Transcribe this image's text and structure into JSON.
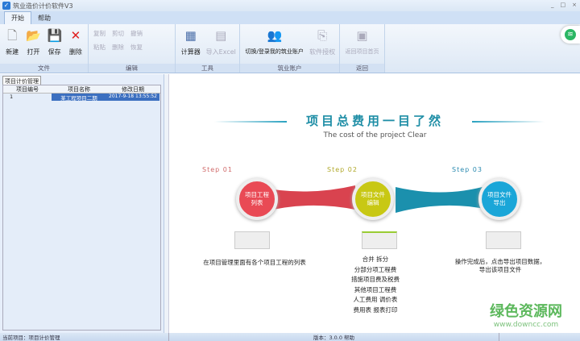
{
  "window": {
    "title": "筑业造价计价软件V3",
    "minimize": "_",
    "maximize": "□",
    "close": "×"
  },
  "tabs": [
    {
      "label": "开始"
    },
    {
      "label": "帮助"
    }
  ],
  "ribbon": {
    "file": {
      "label": "文件",
      "buttons": [
        "新建",
        "打开",
        "保存",
        "删除"
      ]
    },
    "edit": {
      "label": "编辑",
      "buttons": [
        "复制",
        "粘贴",
        "剪切",
        "删除",
        "撤销",
        "恢复"
      ]
    },
    "tools": {
      "label": "工具",
      "buttons": [
        "计算器",
        "导入Excel"
      ]
    },
    "account": {
      "label": "筑业账户",
      "buttons": [
        "切换/登录我的筑业账户",
        "软件授权"
      ]
    },
    "back": {
      "label": "返回",
      "buttons": [
        "返回项目首页"
      ]
    }
  },
  "left": {
    "tab": "项目计价管理",
    "columns": [
      "项目编号",
      "项目名称",
      "修改日期"
    ],
    "rows": [
      {
        "no": "1",
        "name": "某工程项目二期",
        "date": "2017-9-18 13:55:52"
      }
    ]
  },
  "content": {
    "title": "项目总费用一目了然",
    "subtitle": "The cost of the project Clear",
    "steps": [
      {
        "step": "Step 01",
        "label": "项目工程\n列表",
        "desc": "在项目管理里面有各个项目工程的列表",
        "color": "#e94a55",
        "stepcolor": "#d06a6a"
      },
      {
        "step": "Step 02",
        "label": "项目文件\n编辑",
        "desc": "合并  拆分\n分部分项工程费\n措施项目费及税费\n其他项目工程费\n人工费用  调价表\n费用表  报表打印",
        "color": "#c8c814",
        "stepcolor": "#b0a82a"
      },
      {
        "step": "Step 03",
        "label": "项目文件\n导出",
        "desc": "操作完成后，点击导出项目数据，\n导出该项目文件",
        "color": "#1aa6d8",
        "stepcolor": "#2a8ab0"
      }
    ]
  },
  "watermark": {
    "cn": "绿色资源网",
    "url": "www.downcc.com"
  },
  "status": {
    "left": "当前项目：项目计价管理",
    "center": "版本：3.0.0  帮助"
  }
}
